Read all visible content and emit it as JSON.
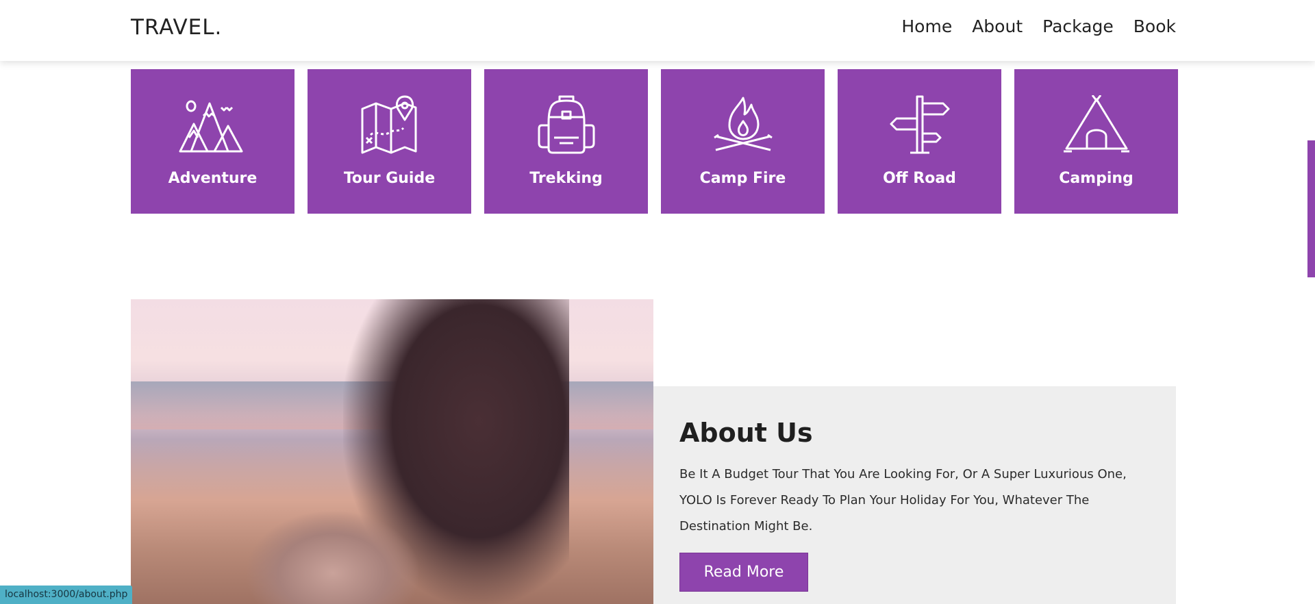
{
  "header": {
    "logo": "TRAVEL.",
    "nav": [
      "Home",
      "About",
      "Package",
      "Book"
    ]
  },
  "services": [
    {
      "label": "Adventure",
      "icon": "mountains-icon"
    },
    {
      "label": "Tour Guide",
      "icon": "map-icon"
    },
    {
      "label": "Trekking",
      "icon": "backpack-icon"
    },
    {
      "label": "Camp Fire",
      "icon": "campfire-icon"
    },
    {
      "label": "Off Road",
      "icon": "signpost-icon"
    },
    {
      "label": "Camping",
      "icon": "tent-icon"
    }
  ],
  "about": {
    "title": "About Us",
    "text": "Be It A Budget Tour That You Are Looking For, Or A Super Luxurious One, YOLO Is Forever Ready To Plan Your Holiday For You, Whatever The Destination Might Be.",
    "button": "Read More"
  },
  "status_bar": "localhost:3000/about.php",
  "colors": {
    "accent": "#8e44ad",
    "about_bg": "#eeeeee",
    "status_bg": "#4fb0c6"
  }
}
